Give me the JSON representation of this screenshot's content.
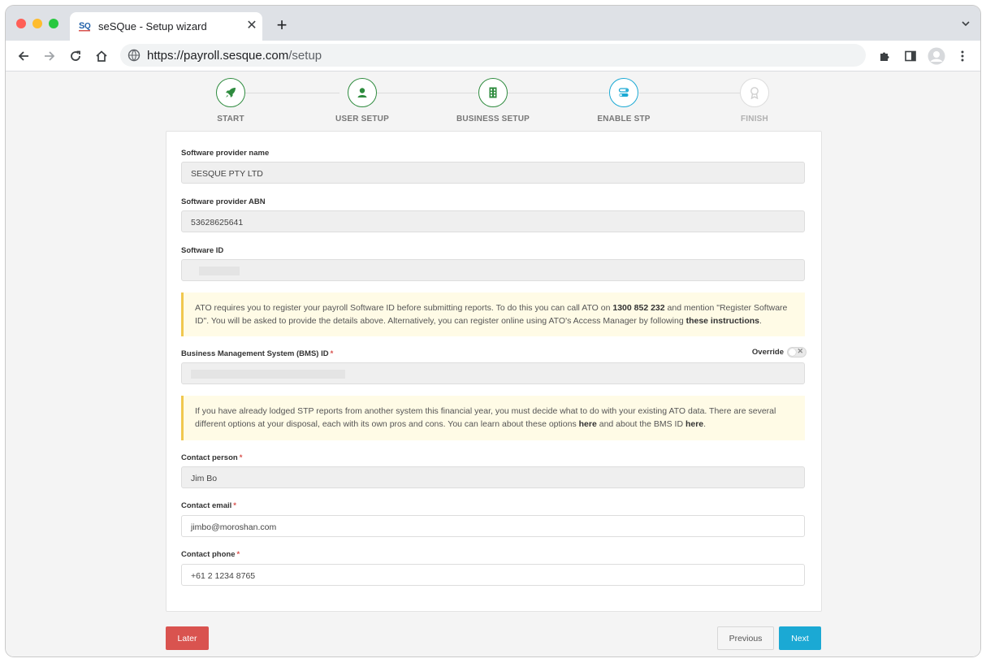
{
  "browser": {
    "tab_title": "seSQue - Setup wizard",
    "url_host": "https://payroll.sesque.com",
    "url_path": "/setup",
    "tab_close": "✕",
    "new_tab": "+"
  },
  "wizard": {
    "steps": [
      {
        "label": "START",
        "icon": "rocket-icon",
        "state": "done"
      },
      {
        "label": "USER SETUP",
        "icon": "user-icon",
        "state": "done"
      },
      {
        "label": "BUSINESS SETUP",
        "icon": "building-icon",
        "state": "done"
      },
      {
        "label": "ENABLE STP",
        "icon": "toggles-icon",
        "state": "active"
      },
      {
        "label": "FINISH",
        "icon": "award-icon",
        "state": "pending"
      }
    ]
  },
  "form": {
    "provider_name_label": "Software provider name",
    "provider_name_value": "SESQUE PTY LTD",
    "provider_abn_label": "Software provider ABN",
    "provider_abn_value": "53628625641",
    "software_id_label": "Software ID",
    "ato_alert": {
      "text1": "ATO requires you to register your payroll Software ID before submitting reports. To do this you can call ATO on ",
      "phone": "1300 852 232",
      "text2": " and mention \"Register Software ID\". You will be asked to provide the details above. Alternatively, you can register online using ATO's Access Manager by following ",
      "link": "these instructions",
      "text3": "."
    },
    "bms_label": "Business Management System (BMS) ID",
    "required_mark": "*",
    "override_label": "Override",
    "toggle_x": "✕",
    "stp_alert": {
      "text1": "If you have already lodged STP reports from another system this financial year, you must decide what to do with your existing ATO data. There are several different options at your disposal, each with its own pros and cons. You can learn about these options ",
      "link1": "here",
      "text2": " and about the BMS ID ",
      "link2": "here",
      "text3": "."
    },
    "contact_person_label": "Contact person",
    "contact_person_value": "Jim Bo",
    "contact_email_label": "Contact email",
    "contact_email_value": "jimbo@moroshan.com",
    "contact_phone_label": "Contact phone",
    "contact_phone_value": "+61 2 1234 8765"
  },
  "buttons": {
    "later": "Later",
    "previous": "Previous",
    "next": "Next"
  },
  "colors": {
    "step_done": "#2e8b3e",
    "step_active": "#1ba9d4",
    "later": "#d9534f",
    "next": "#1ba9d4",
    "alert_bg": "#fffbe6",
    "alert_border": "#f0c84f"
  }
}
